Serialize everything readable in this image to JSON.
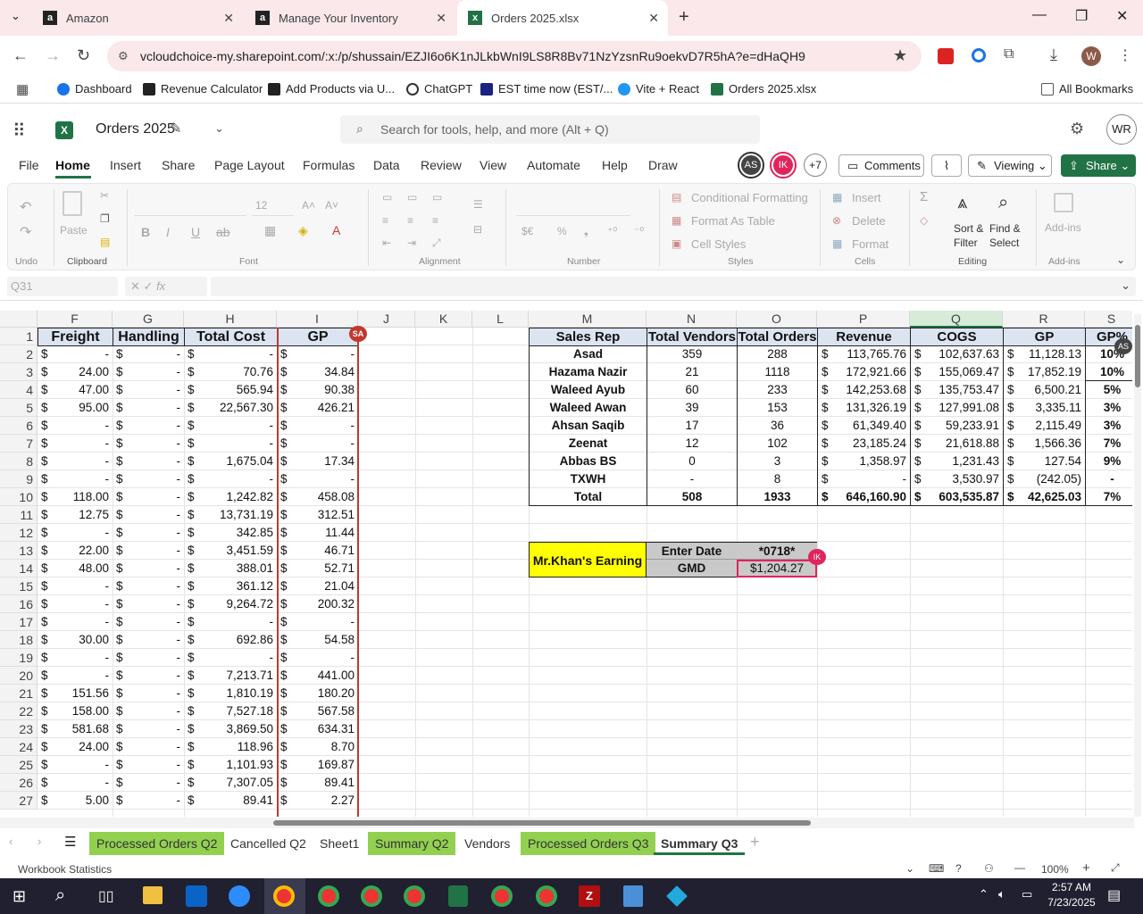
{
  "browser": {
    "tabs": [
      {
        "label": "Amazon"
      },
      {
        "label": "Manage Your Inventory"
      },
      {
        "label": "Orders 2025.xlsx"
      }
    ],
    "url": "vcloudchoice-my.sharepoint.com/:x:/p/shussain/EZJI6o6K1nJLkbWnI9LS8R8Bv71NzYzsnRu9oekvD7R5hA?e=dHaQH9",
    "bookmarks": [
      "Dashboard",
      "Revenue Calculator",
      "Add Products via U...",
      "ChatGPT",
      "EST time now (EST/...",
      "Vite + React",
      "Orders 2025.xlsx"
    ],
    "all_bookmarks": "All Bookmarks",
    "profile": "W"
  },
  "excel": {
    "doc_title": "Orders 2025",
    "search_placeholder": "Search for tools, help, and more (Alt + Q)",
    "user_initials": "WR",
    "menus": [
      "File",
      "Home",
      "Insert",
      "Share",
      "Page Layout",
      "Formulas",
      "Data",
      "Review",
      "View",
      "Automate",
      "Help",
      "Draw"
    ],
    "collab": {
      "a": "AS",
      "b": "IK",
      "more": "+7"
    },
    "comments": "Comments",
    "viewing": "Viewing",
    "share": "Share",
    "ribbon": {
      "undo": "Undo",
      "clipboard": "Clipboard",
      "font": "Font",
      "alignment": "Alignment",
      "number": "Number",
      "styles": "Styles",
      "cells": "Cells",
      "editing": "Editing",
      "addins": "Add-ins",
      "paste": "Paste",
      "font_size": "12",
      "cond_fmt": "Conditional Formatting",
      "fmt_table": "Format As Table",
      "cell_styles": "Cell Styles",
      "insert": "Insert",
      "delete": "Delete",
      "format": "Format",
      "sort": "Sort & Filter",
      "find": "Find & Select",
      "addins_btn": "Add-ins"
    },
    "namebox": "Q31",
    "fx": "fx"
  },
  "grid": {
    "columns": [
      "F",
      "G",
      "H",
      "I",
      "J",
      "K",
      "L",
      "M",
      "N",
      "O",
      "P",
      "Q",
      "R",
      "S"
    ],
    "rows": [
      "1",
      "2",
      "3",
      "4",
      "5",
      "6",
      "7",
      "8",
      "9",
      "10",
      "11",
      "12",
      "13",
      "14",
      "15",
      "16",
      "17",
      "18",
      "19",
      "20",
      "21",
      "22",
      "23",
      "24",
      "25",
      "26",
      "27"
    ],
    "left_headers": [
      "Freight",
      "Handling",
      "Total Cost",
      "GP"
    ],
    "left_data": [
      [
        "-",
        "-",
        "-",
        "-"
      ],
      [
        "24.00",
        "-",
        "70.76",
        "34.84"
      ],
      [
        "47.00",
        "-",
        "565.94",
        "90.38"
      ],
      [
        "95.00",
        "-",
        "22,567.30",
        "426.21"
      ],
      [
        "-",
        "-",
        "-",
        "-"
      ],
      [
        "-",
        "-",
        "-",
        "-"
      ],
      [
        "-",
        "-",
        "1,675.04",
        "17.34"
      ],
      [
        "-",
        "-",
        "-",
        "-"
      ],
      [
        "118.00",
        "-",
        "1,242.82",
        "458.08"
      ],
      [
        "12.75",
        "-",
        "13,731.19",
        "312.51"
      ],
      [
        "-",
        "-",
        "342.85",
        "11.44"
      ],
      [
        "22.00",
        "-",
        "3,451.59",
        "46.71"
      ],
      [
        "48.00",
        "-",
        "388.01",
        "52.71"
      ],
      [
        "-",
        "-",
        "361.12",
        "21.04"
      ],
      [
        "-",
        "-",
        "9,264.72",
        "200.32"
      ],
      [
        "-",
        "-",
        "-",
        "-"
      ],
      [
        "30.00",
        "-",
        "692.86",
        "54.58"
      ],
      [
        "-",
        "-",
        "-",
        "-"
      ],
      [
        "-",
        "-",
        "7,213.71",
        "441.00"
      ],
      [
        "151.56",
        "-",
        "1,810.19",
        "180.20"
      ],
      [
        "158.00",
        "-",
        "7,527.18",
        "567.58"
      ],
      [
        "581.68",
        "-",
        "3,869.50",
        "634.31"
      ],
      [
        "24.00",
        "-",
        "118.96",
        "8.70"
      ],
      [
        "-",
        "-",
        "1,101.93",
        "169.87"
      ],
      [
        "-",
        "-",
        "7,307.05",
        "89.41"
      ],
      [
        "5.00",
        "-",
        "89.41",
        "2.27"
      ]
    ],
    "summary_headers": [
      "Sales Rep",
      "Total Vendors",
      "Total Orders",
      "Revenue",
      "COGS",
      "GP",
      "GP%"
    ],
    "summary": [
      [
        "Asad",
        "359",
        "288",
        "113,765.76",
        "102,637.63",
        "11,128.13",
        "10%"
      ],
      [
        "Hazama Nazir",
        "21",
        "1118",
        "172,921.66",
        "155,069.47",
        "17,852.19",
        "10%"
      ],
      [
        "Waleed Ayub",
        "60",
        "233",
        "142,253.68",
        "135,753.47",
        "6,500.21",
        "5%"
      ],
      [
        "Waleed Awan",
        "39",
        "153",
        "131,326.19",
        "127,991.08",
        "3,335.11",
        "3%"
      ],
      [
        "Ahsan Saqib",
        "17",
        "36",
        "61,349.40",
        "59,233.91",
        "2,115.49",
        "3%"
      ],
      [
        "Zeenat",
        "12",
        "102",
        "23,185.24",
        "21,618.88",
        "1,566.36",
        "7%"
      ],
      [
        "Abbas BS",
        "0",
        "3",
        "1,358.97",
        "1,231.43",
        "127.54",
        "9%"
      ],
      [
        "TXWH",
        "-",
        "8",
        "-",
        "3,530.97",
        "(242.05)",
        "-"
      ],
      [
        "Total",
        "508",
        "1933",
        "646,160.90",
        "603,535.87",
        "42,625.03",
        "7%"
      ]
    ],
    "dollar": "$",
    "earning_label": "Mr.Khan's Earning",
    "enter_date": "Enter Date",
    "date_value": "*0718*",
    "gmd": "GMD",
    "gmd_value": "$1,204.27",
    "badge_sa": "SA",
    "badge_as": "AS",
    "badge_ik": "IK"
  },
  "sheets": [
    {
      "label": "Processed Orders Q2",
      "green": true
    },
    {
      "label": "Cancelled Q2",
      "green": false
    },
    {
      "label": "Sheet1",
      "green": false
    },
    {
      "label": "Summary Q2",
      "green": true
    },
    {
      "label": "Vendors",
      "green": false
    },
    {
      "label": "Processed Orders Q3",
      "green": true
    },
    {
      "label": "Summary Q3",
      "green": false,
      "active": true
    }
  ],
  "status": {
    "left": "Workbook Statistics",
    "zoom": "100%"
  },
  "taskbar": {
    "time": "2:57 AM",
    "date": "7/23/2025"
  },
  "colors": {
    "accent": "#217346",
    "header_fill": "#dbe4f0",
    "yellow": "#ffff00",
    "tab_green": "#92d050",
    "badge_red": "#e0245e"
  }
}
